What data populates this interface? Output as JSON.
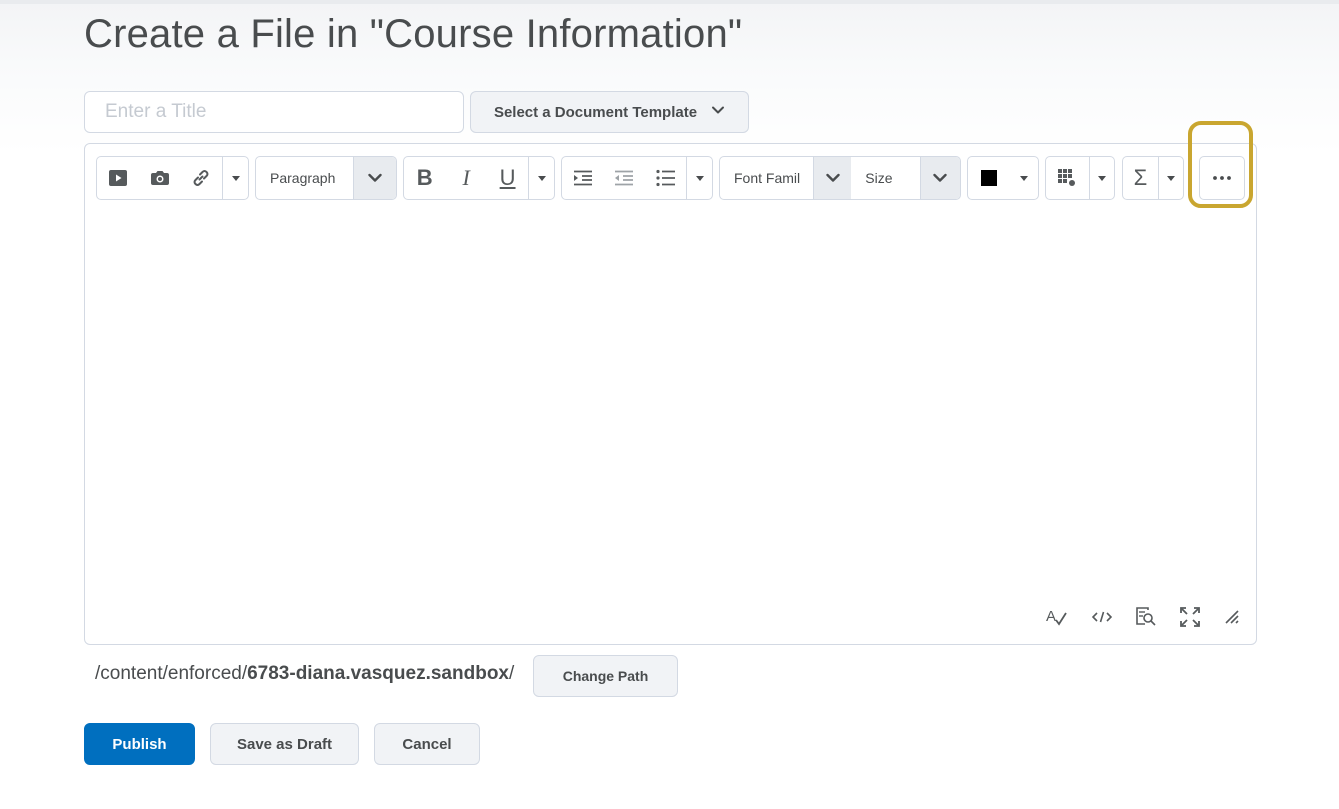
{
  "page": {
    "title": "Create a File in \"Course Information\""
  },
  "title_field": {
    "placeholder": "Enter a Title",
    "value": ""
  },
  "template_button": {
    "label": "Select a Document Template",
    "icon": "chevron-down-icon"
  },
  "toolbar": {
    "insert_group": {
      "icons": [
        "video-icon",
        "camera-icon",
        "link-icon",
        "dropdown-caret-icon"
      ]
    },
    "block_format": {
      "label": "Paragraph"
    },
    "text_style": {
      "icons": [
        "bold-icon",
        "italic-icon",
        "underline-icon",
        "dropdown-caret-icon"
      ]
    },
    "lists": {
      "icons": [
        "indent-icon",
        "outdent-icon",
        "bullet-list-icon",
        "dropdown-caret-icon"
      ]
    },
    "font_family": {
      "label": "Font Famil"
    },
    "font_size": {
      "label": "Size"
    },
    "color": {
      "value": "#000000"
    },
    "table": {
      "icon": "table-icon"
    },
    "equation": {
      "icon": "sigma-icon"
    },
    "more": {
      "icon": "more-icon",
      "highlight_color": "#c9a630"
    }
  },
  "editor_status": {
    "icons": [
      "spellcheck-icon",
      "source-code-icon",
      "preview-icon",
      "fullscreen-icon",
      "resize-icon"
    ]
  },
  "path": {
    "prefix": "/content/enforced/",
    "folder": "6783-diana.vasquez.sandbox",
    "suffix": "/",
    "change_label": "Change Path"
  },
  "actions": {
    "publish": "Publish",
    "save_draft": "Save as Draft",
    "cancel": "Cancel"
  },
  "colors": {
    "primary": "#006fbf",
    "text": "#494c4e",
    "border": "#d3d9e3",
    "highlight": "#c9a630"
  }
}
